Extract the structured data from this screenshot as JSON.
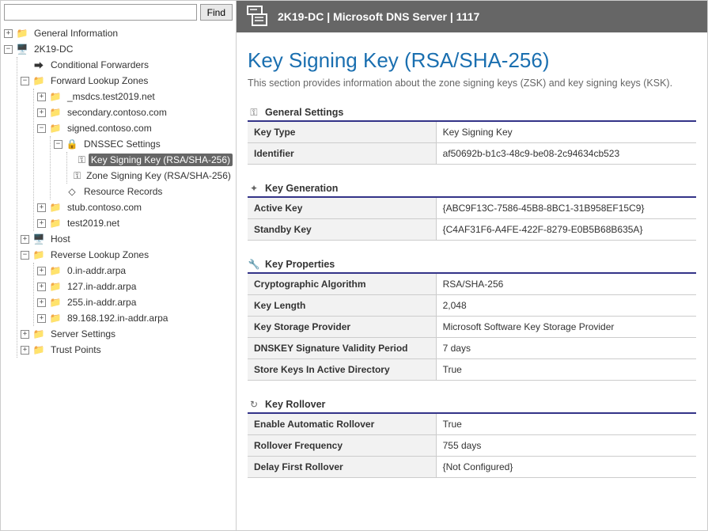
{
  "search": {
    "placeholder": "",
    "find_label": "Find"
  },
  "tree": {
    "general_info": "General Information",
    "server": "2K19-DC",
    "conditional_forwarders": "Conditional Forwarders",
    "flz": "Forward Lookup Zones",
    "flz_msdcs": "_msdcs.test2019.net",
    "flz_secondary": "secondary.contoso.com",
    "flz_signed": "signed.contoso.com",
    "dnssec": "DNSSEC Settings",
    "ksk": "Key Signing Key (RSA/SHA-256)",
    "zsk": "Zone Signing Key (RSA/SHA-256)",
    "resource_records": "Resource Records",
    "flz_stub": "stub.contoso.com",
    "flz_test2019": "test2019.net",
    "host": "Host",
    "rlz": "Reverse Lookup Zones",
    "rlz_0": "0.in-addr.arpa",
    "rlz_127": "127.in-addr.arpa",
    "rlz_255": "255.in-addr.arpa",
    "rlz_89": "89.168.192.in-addr.arpa",
    "server_settings": "Server Settings",
    "trust_points": "Trust Points"
  },
  "header": {
    "title": "2K19-DC | Microsoft DNS Server | 1117"
  },
  "page": {
    "title": "Key Signing Key (RSA/SHA-256)",
    "subtitle": "This section provides information about the zone signing keys (ZSK) and key signing keys (KSK)."
  },
  "sections": {
    "general": {
      "title": "General Settings",
      "rows": [
        {
          "k": "Key Type",
          "v": "Key Signing Key"
        },
        {
          "k": "Identifier",
          "v": "af50692b-b1c3-48c9-be08-2c94634cb523"
        }
      ]
    },
    "generation": {
      "title": "Key Generation",
      "rows": [
        {
          "k": "Active Key",
          "v": "{ABC9F13C-7586-45B8-8BC1-31B958EF15C9}"
        },
        {
          "k": "Standby Key",
          "v": "{C4AF31F6-A4FE-422F-8279-E0B5B68B635A}"
        }
      ]
    },
    "properties": {
      "title": "Key Properties",
      "rows": [
        {
          "k": "Cryptographic Algorithm",
          "v": "RSA/SHA-256"
        },
        {
          "k": "Key Length",
          "v": "2,048"
        },
        {
          "k": "Key Storage Provider",
          "v": "Microsoft Software Key Storage Provider"
        },
        {
          "k": "DNSKEY Signature Validity Period",
          "v": "7 days"
        },
        {
          "k": "Store Keys In Active Directory",
          "v": "True"
        }
      ]
    },
    "rollover": {
      "title": "Key Rollover",
      "rows": [
        {
          "k": "Enable Automatic Rollover",
          "v": "True"
        },
        {
          "k": "Rollover Frequency",
          "v": "755 days"
        },
        {
          "k": "Delay First Rollover",
          "v": "{Not Configured}"
        }
      ]
    }
  }
}
